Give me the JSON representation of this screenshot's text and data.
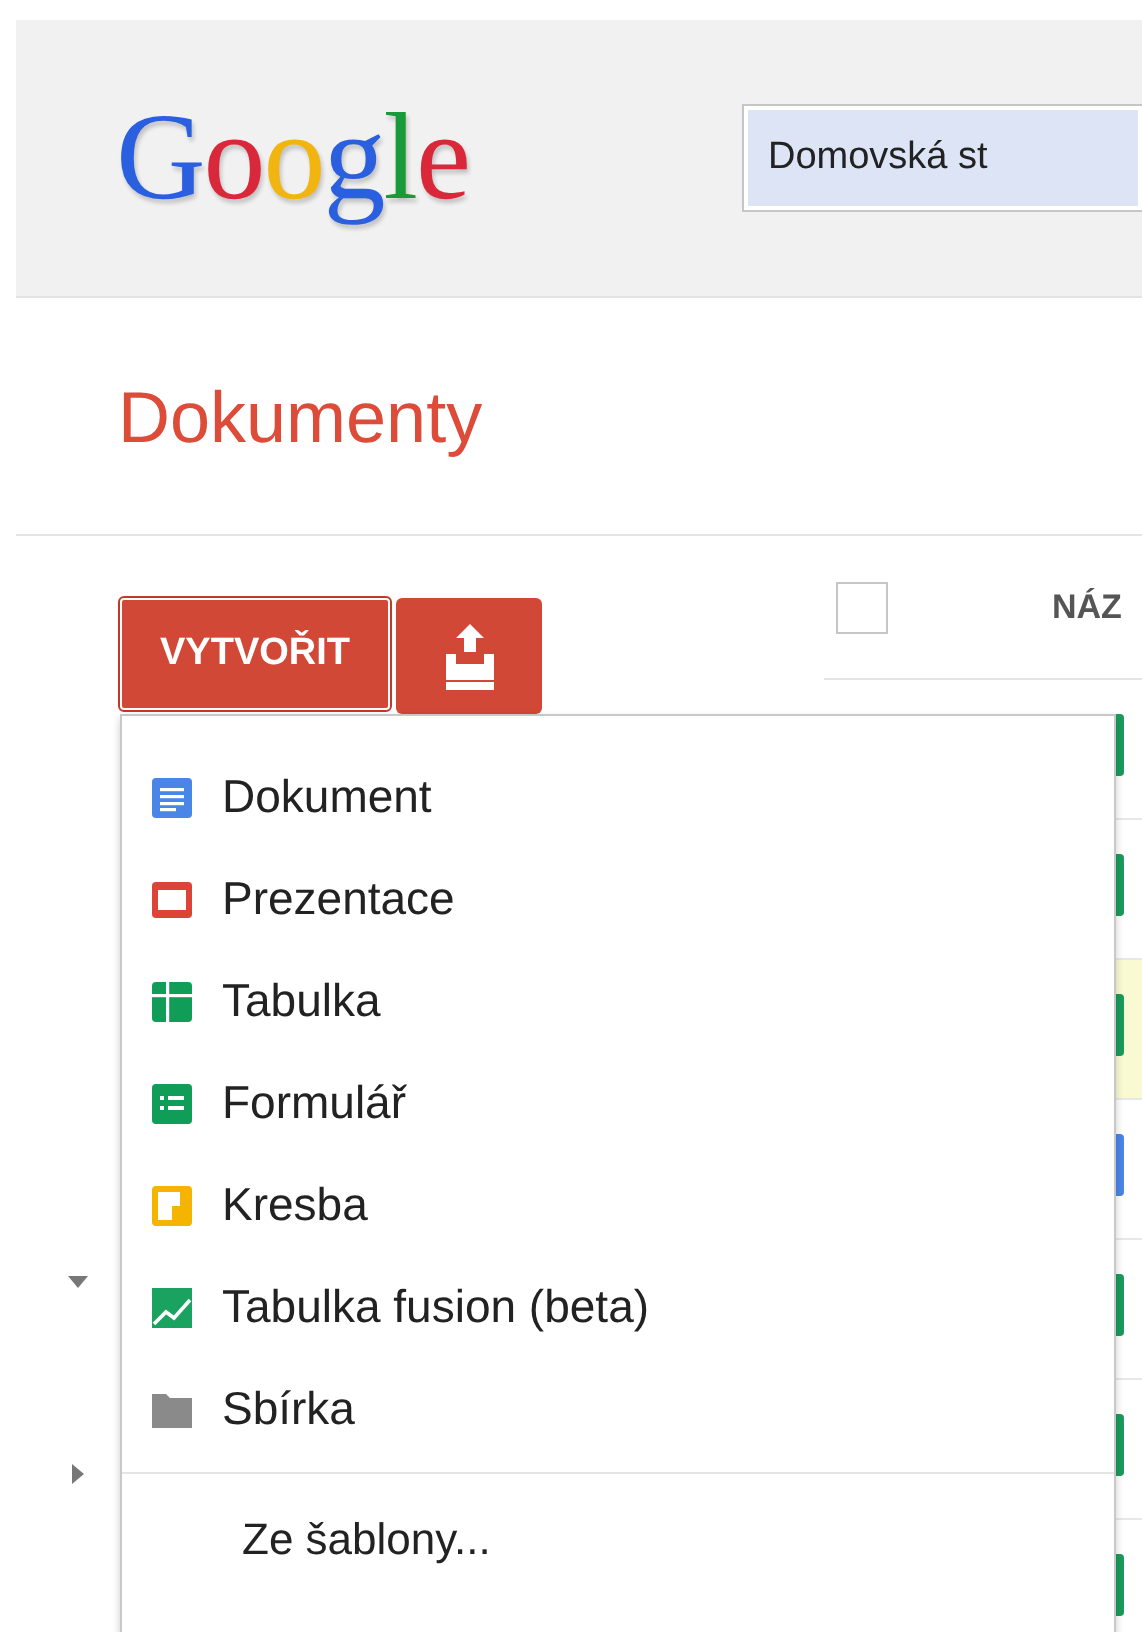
{
  "logo": [
    {
      "letter": "G",
      "color": "#2a5fe0"
    },
    {
      "letter": "o",
      "color": "#d8283a"
    },
    {
      "letter": "o",
      "color": "#f2b40f"
    },
    {
      "letter": "g",
      "color": "#2a5fe0"
    },
    {
      "letter": "l",
      "color": "#189a3b"
    },
    {
      "letter": "e",
      "color": "#d8283a"
    }
  ],
  "search": {
    "value": "Domovská st"
  },
  "page_title": "Dokumenty",
  "create_button": "VYTVOŘIT",
  "table": {
    "column_header": "NÁZ",
    "select_all_checked": false
  },
  "tree": [
    {
      "expanded": true
    },
    {
      "expanded": false
    }
  ],
  "file_rows": [
    {
      "color": "#1a9c5b",
      "highlighted": false
    },
    {
      "color": "#1a9c5b",
      "highlighted": false
    },
    {
      "color": "#1a9c5b",
      "highlighted": true
    },
    {
      "color": "#4a86e8",
      "highlighted": false
    },
    {
      "color": "#1a9c5b",
      "highlighted": false
    },
    {
      "color": "#1a9c5b",
      "highlighted": false
    },
    {
      "color": "#1a9c5b",
      "highlighted": false
    }
  ],
  "create_menu": {
    "items": [
      {
        "kind": "document",
        "label": "Dokument"
      },
      {
        "kind": "presentation",
        "label": "Prezentace"
      },
      {
        "kind": "spreadsheet",
        "label": "Tabulka"
      },
      {
        "kind": "form",
        "label": "Formulář"
      },
      {
        "kind": "drawing",
        "label": "Kresba"
      },
      {
        "kind": "fusion",
        "label": "Tabulka fusion (beta)"
      },
      {
        "kind": "collection",
        "label": "Sbírka"
      }
    ],
    "footer_item": "Ze šablony..."
  }
}
